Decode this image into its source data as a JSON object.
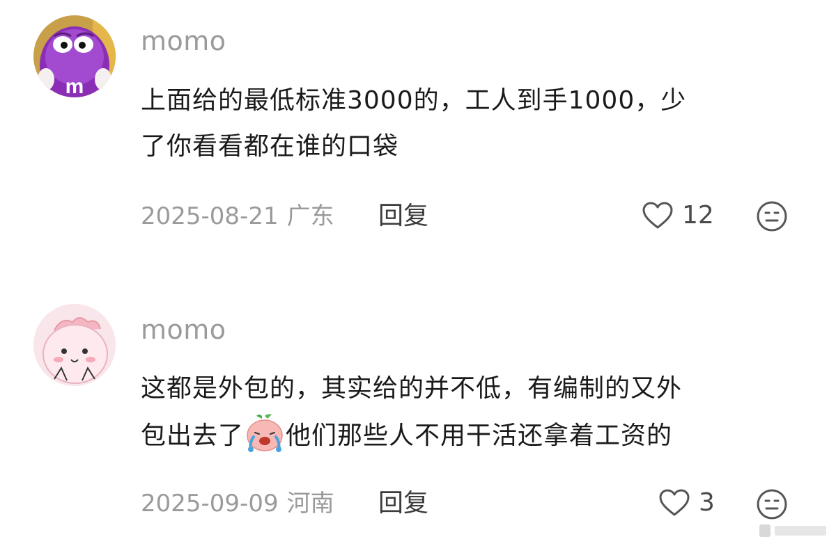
{
  "comments": [
    {
      "avatar": "purple-candy-mascot-avatar",
      "username": "momo",
      "text_lines": [
        "上面给的最低标准3000的，工人到手1000，少",
        "了你看看都在谁的口袋"
      ],
      "date": "2025-08-21",
      "location": "广东",
      "reply_label": "回复",
      "likes": "12"
    },
    {
      "avatar": "pink-dinosaur-avatar",
      "username": "momo",
      "text_line1": "这都是外包的，其实给的并不低，有编制的又外",
      "text_line2_before": "包出去了",
      "text_emoji": "crying-peach-emoji",
      "text_line2_after": "他们那些人不用干活还拿着工资的",
      "date": "2025-09-09",
      "location": "河南",
      "reply_label": "回复",
      "likes": "3"
    }
  ],
  "colors": {
    "username": "#9a9a9a",
    "body": "#1a1a1a",
    "meta": "#9a9a9a",
    "icon": "#555555",
    "avatar1": "#8a2fb5",
    "avatar2": "#f9e6ea"
  }
}
